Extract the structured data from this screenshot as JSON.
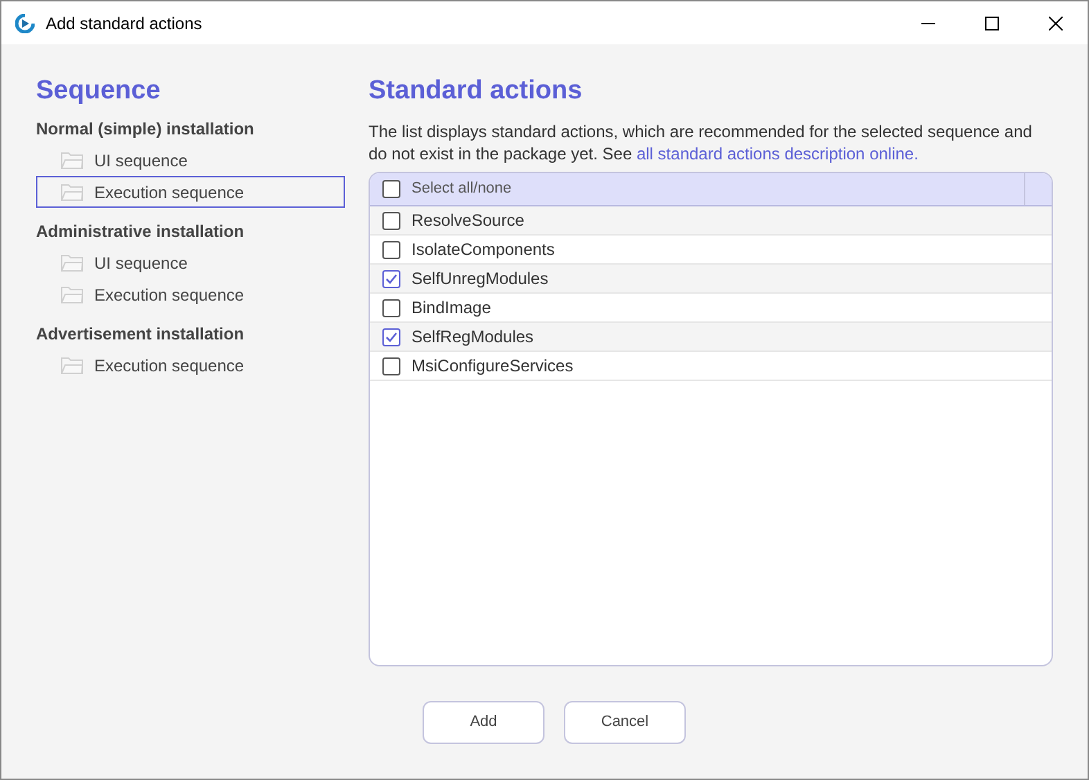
{
  "window": {
    "title": "Add standard actions"
  },
  "sequence": {
    "heading": "Sequence",
    "groups": [
      {
        "label": "Normal (simple) installation",
        "children": [
          {
            "label": "UI sequence",
            "selected": false
          },
          {
            "label": "Execution sequence",
            "selected": true
          }
        ]
      },
      {
        "label": "Administrative installation",
        "children": [
          {
            "label": "UI sequence",
            "selected": false
          },
          {
            "label": "Execution sequence",
            "selected": false
          }
        ]
      },
      {
        "label": "Advertisement installation",
        "children": [
          {
            "label": "Execution sequence",
            "selected": false
          }
        ]
      }
    ]
  },
  "actions": {
    "heading": "Standard actions",
    "description": "The list displays standard actions, which are recommended for the selected sequence and do not exist in the package yet. See",
    "link": "all standard actions description online.",
    "select_all": {
      "label": "Select all/none",
      "checked": false
    },
    "rows": [
      {
        "label": "ResolveSource",
        "checked": false
      },
      {
        "label": "IsolateComponents",
        "checked": false
      },
      {
        "label": "SelfUnregModules",
        "checked": true
      },
      {
        "label": "BindImage",
        "checked": false
      },
      {
        "label": "SelfRegModules",
        "checked": true
      },
      {
        "label": "MsiConfigureServices",
        "checked": false
      }
    ]
  },
  "buttons": [
    "Add",
    "Cancel"
  ]
}
